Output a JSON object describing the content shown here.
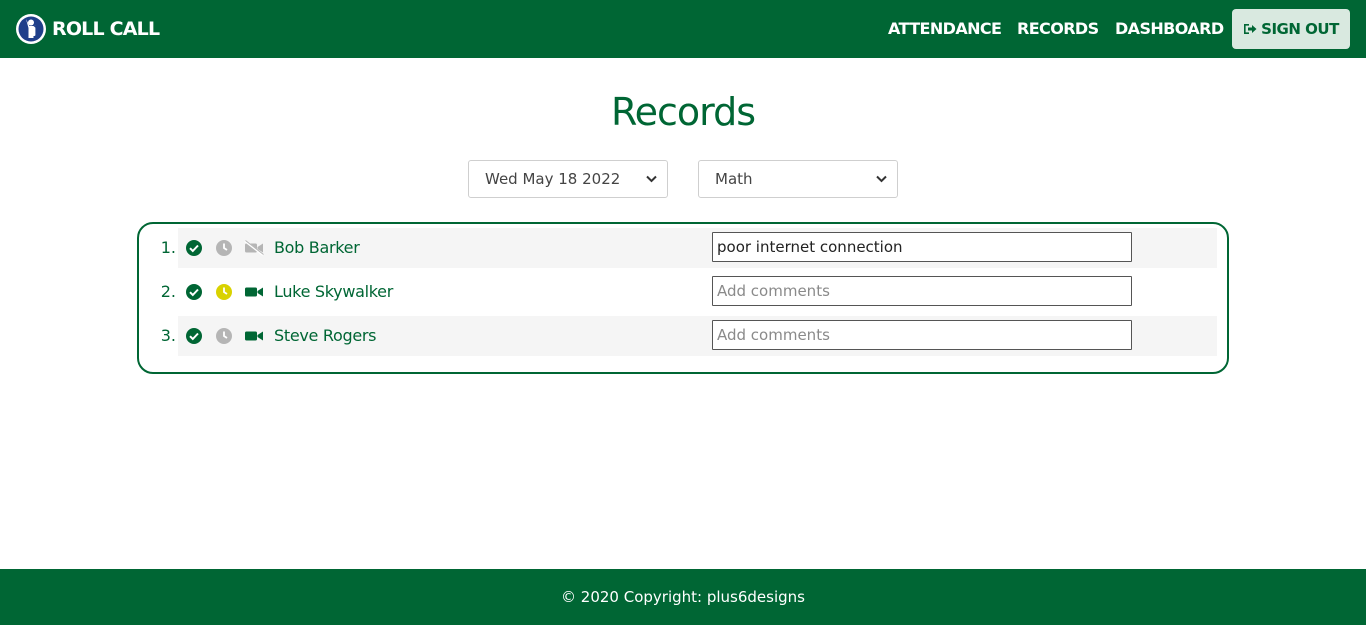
{
  "brand": {
    "name": "ROLL CALL",
    "logo_icon": "person-raising-hand-logo"
  },
  "nav": {
    "attendance": "ATTENDANCE",
    "records": "RECORDS",
    "dashboard": "DASHBOARD",
    "signout": "SIGN OUT",
    "signout_icon": "sign-out-icon"
  },
  "page_title": "Records",
  "filters": {
    "date_selected": "Wed May 18 2022",
    "class_selected": "Math"
  },
  "records": [
    {
      "number": "1.",
      "name": "Bob Barker",
      "present": true,
      "late": false,
      "camera_on": false,
      "comment": "poor internet connection",
      "comment_placeholder": "Add comments"
    },
    {
      "number": "2.",
      "name": "Luke Skywalker",
      "present": true,
      "late": true,
      "camera_on": true,
      "comment": "",
      "comment_placeholder": "Add comments"
    },
    {
      "number": "3.",
      "name": "Steve Rogers",
      "present": true,
      "late": false,
      "camera_on": true,
      "comment": "",
      "comment_placeholder": "Add comments"
    }
  ],
  "footer": {
    "copyright": "© 2020 Copyright: plus6designs"
  },
  "colors": {
    "primary": "#006634",
    "present": "#006634",
    "late": "#d9d200",
    "inactive": "#b5b5b5",
    "signout_bg": "#d9e9e0",
    "row_stripe": "#f5f5f5"
  }
}
